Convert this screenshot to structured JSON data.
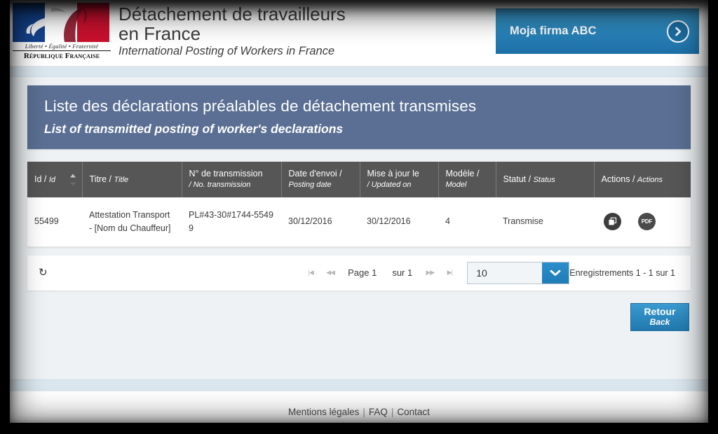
{
  "header": {
    "logo": {
      "motto": "Liberté • Égalité • Fraternité",
      "republic": "République Française",
      "alt": "marianne-logo"
    },
    "title_fr": "Détachement de travailleurs en France",
    "title_en": "International Posting of Workers in France",
    "company": {
      "name": "Moja firma ABC",
      "arrow_icon": "chevron-right-icon"
    }
  },
  "banner": {
    "title_fr": "Liste des déclarations préalables de détachement transmises",
    "title_en": "List of transmitted posting of worker's declarations"
  },
  "table": {
    "columns": [
      {
        "fr": "Id / ",
        "en": "Id",
        "sortable": true
      },
      {
        "fr": "Titre / ",
        "en": "Title",
        "sortable": false
      },
      {
        "fr": "N° de transmission",
        "en": "/ No. transmission",
        "two_line": true
      },
      {
        "fr": "Date d'envoi /",
        "en": "Posting date",
        "two_line": true
      },
      {
        "fr": "Mise à jour le",
        "en": "/ Updated on",
        "two_line": true
      },
      {
        "fr": "Modèle /",
        "en": "Model",
        "two_line": true
      },
      {
        "fr": "Statut / ",
        "en": "Status",
        "sortable": false
      },
      {
        "fr": "Actions / ",
        "en": "Actions",
        "sortable": false
      }
    ],
    "rows": [
      {
        "id": "55499",
        "titre": "Attestation Transport - [Nom du Chauffeur]",
        "no_transmission": "PL#43-30#1744-55499",
        "date_envoi": "30/12/2016",
        "mise_a_jour": "30/12/2016",
        "modele": "4",
        "statut": "Transmise",
        "actions": [
          {
            "icon": "copy-icon",
            "label": "Dupliquer"
          },
          {
            "icon": "pdf-icon",
            "label": "PDF"
          }
        ]
      }
    ]
  },
  "paginator": {
    "refresh_icon": "refresh-icon",
    "first_icon": "first-page-icon",
    "prev_icon": "previous-page-icon",
    "next_icon": "next-page-icon",
    "last_icon": "last-page-icon",
    "page_label": "Page 1",
    "of_label": "sur 1",
    "page_size": "10",
    "dropdown_icon": "chevron-down-icon",
    "records_label": "Enregistrements 1 - 1 sur 1"
  },
  "back_button": {
    "label_fr": "Retour",
    "label_en": "Back"
  },
  "footer": {
    "links": [
      "Mentions légales",
      "FAQ",
      "Contact"
    ],
    "separator": "|"
  },
  "colors": {
    "banner_blue": "#5a6f93",
    "table_header_gray": "#565656",
    "accent_blue": "#2b87bd",
    "strip_blue": "#dbe7ef",
    "content_bg": "#eef2f4"
  }
}
